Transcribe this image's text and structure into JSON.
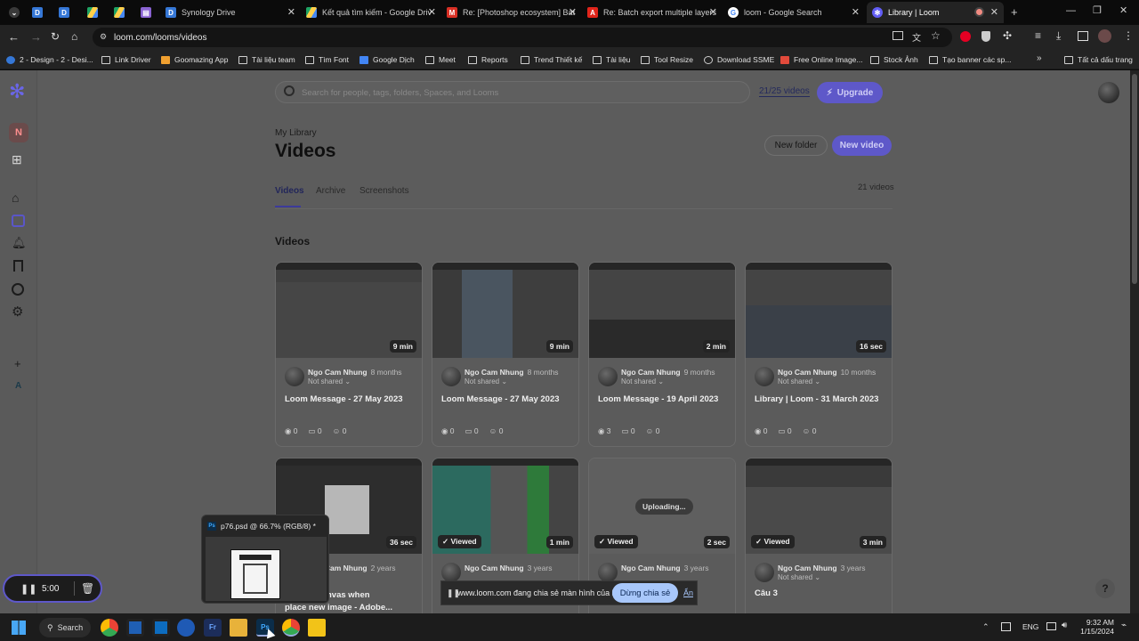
{
  "tabs": [
    {
      "label": "",
      "icon": "chevron-down-icon"
    },
    {
      "label": "",
      "icon": "synology-drive-icon"
    },
    {
      "label": "",
      "icon": "synology-drive-icon"
    },
    {
      "label": "",
      "icon": "google-drive-icon"
    },
    {
      "label": "",
      "icon": "google-drive-icon"
    },
    {
      "label": "",
      "icon": "notion-icon"
    },
    {
      "label": "Synology Drive",
      "icon": "synology-drive-icon"
    },
    {
      "label": "Kết quả tìm kiếm - Google Driv",
      "icon": "google-drive-icon"
    },
    {
      "label": "Re: [Photoshop ecosystem] Bat",
      "icon": "gmail-icon"
    },
    {
      "label": "Re: Batch export multiple layers",
      "icon": "adobe-icon"
    },
    {
      "label": "loom - Google Search",
      "icon": "google-icon"
    },
    {
      "label": "Library | Loom",
      "icon": "loom-icon"
    }
  ],
  "address": {
    "url": "loom.com/looms/videos"
  },
  "bookmarks": [
    "2 - Design - 2 - Desi...",
    "Link Driver",
    "Goomazing App",
    "Tài liệu team",
    "Tìm Font",
    "Google Dịch",
    "Meet",
    "Reports",
    "Trend Thiết kế",
    "Tài liệu",
    "Tool Resize",
    "Download SSME",
    "Free Online Image...",
    "Stock Ảnh",
    "Tạo banner các sp...",
    "Tất cả dấu trang"
  ],
  "sidebar": {
    "workspace_initial": "N",
    "add_label": "+",
    "workspace_b": "A"
  },
  "header": {
    "search_placeholder": "Search for people, tags, folders, Spaces, and Looms",
    "quota": "21/25 videos",
    "upgrade": "Upgrade"
  },
  "library": {
    "breadcrumb": "My Library",
    "title": "Videos",
    "new_folder": "New folder",
    "new_video": "New video",
    "tabs": [
      "Videos",
      "Archive",
      "Screenshots"
    ],
    "count": "21 videos",
    "section": "Videos"
  },
  "cards": [
    {
      "duration": "9 min",
      "author": "Ngo Cam Nhung",
      "age": "8 months",
      "shared": "Not shared",
      "title": "Loom Message - 27 May 2023",
      "views": "0",
      "comments": "0",
      "reactions": "0",
      "viewed": "",
      "status": ""
    },
    {
      "duration": "9 min",
      "author": "Ngo Cam Nhung",
      "age": "8 months",
      "shared": "Not shared",
      "title": "Loom Message - 27 May 2023",
      "views": "0",
      "comments": "0",
      "reactions": "0",
      "viewed": "",
      "status": ""
    },
    {
      "duration": "2 min",
      "author": "Ngo Cam Nhung",
      "age": "9 months",
      "shared": "Not shared",
      "title": "Loom Message - 19 April 2023",
      "views": "3",
      "comments": "0",
      "reactions": "0",
      "viewed": "",
      "status": ""
    },
    {
      "duration": "16 sec",
      "author": "Ngo Cam Nhung",
      "age": "10 months",
      "shared": "Not shared",
      "title": "Library | Loom - 31 March 2023",
      "views": "0",
      "comments": "0",
      "reactions": "0",
      "viewed": "",
      "status": ""
    },
    {
      "duration": "36 sec",
      "author": "Ngo Cam Nhung",
      "age": "2 years",
      "shared": "",
      "title": "lly fit to canvas when",
      "title2": "place new image - Adobe...",
      "views": "",
      "comments": "",
      "reactions": "",
      "viewed": "",
      "status": ""
    },
    {
      "duration": "1 min",
      "author": "Ngo Cam Nhung",
      "age": "3 years",
      "shared": "",
      "title": "",
      "views": "",
      "comments": "",
      "reactions": "",
      "viewed": "Viewed",
      "status": ""
    },
    {
      "duration": "2 sec",
      "author": "Ngo Cam Nhung",
      "age": "3 years",
      "shared": "",
      "title": "",
      "views": "",
      "comments": "",
      "reactions": "",
      "viewed": "Viewed",
      "status": "Uploading..."
    },
    {
      "duration": "3 min",
      "author": "Ngo Cam Nhung",
      "age": "3 years",
      "shared": "Not shared",
      "title": "Câu 3",
      "views": "",
      "comments": "",
      "reactions": "",
      "viewed": "Viewed",
      "status": ""
    }
  ],
  "recorder": {
    "time": "5:00"
  },
  "ps_preview": {
    "title": "p76.psd @ 66.7% (RGB/8) *"
  },
  "share_bar": {
    "message": "www.loom.com đang chia sẻ màn hình của bạn.",
    "stop": "Dừng chia sẻ",
    "hide": "Ẩn"
  },
  "help": "?",
  "taskbar": {
    "search": "Search",
    "lang": "ENG",
    "time": "9:32 AM",
    "date": "1/15/2024"
  },
  "colors": {
    "accent": "#6b5fd6",
    "page_bg": "#5c5c5c",
    "chrome_bg": "#232323"
  }
}
